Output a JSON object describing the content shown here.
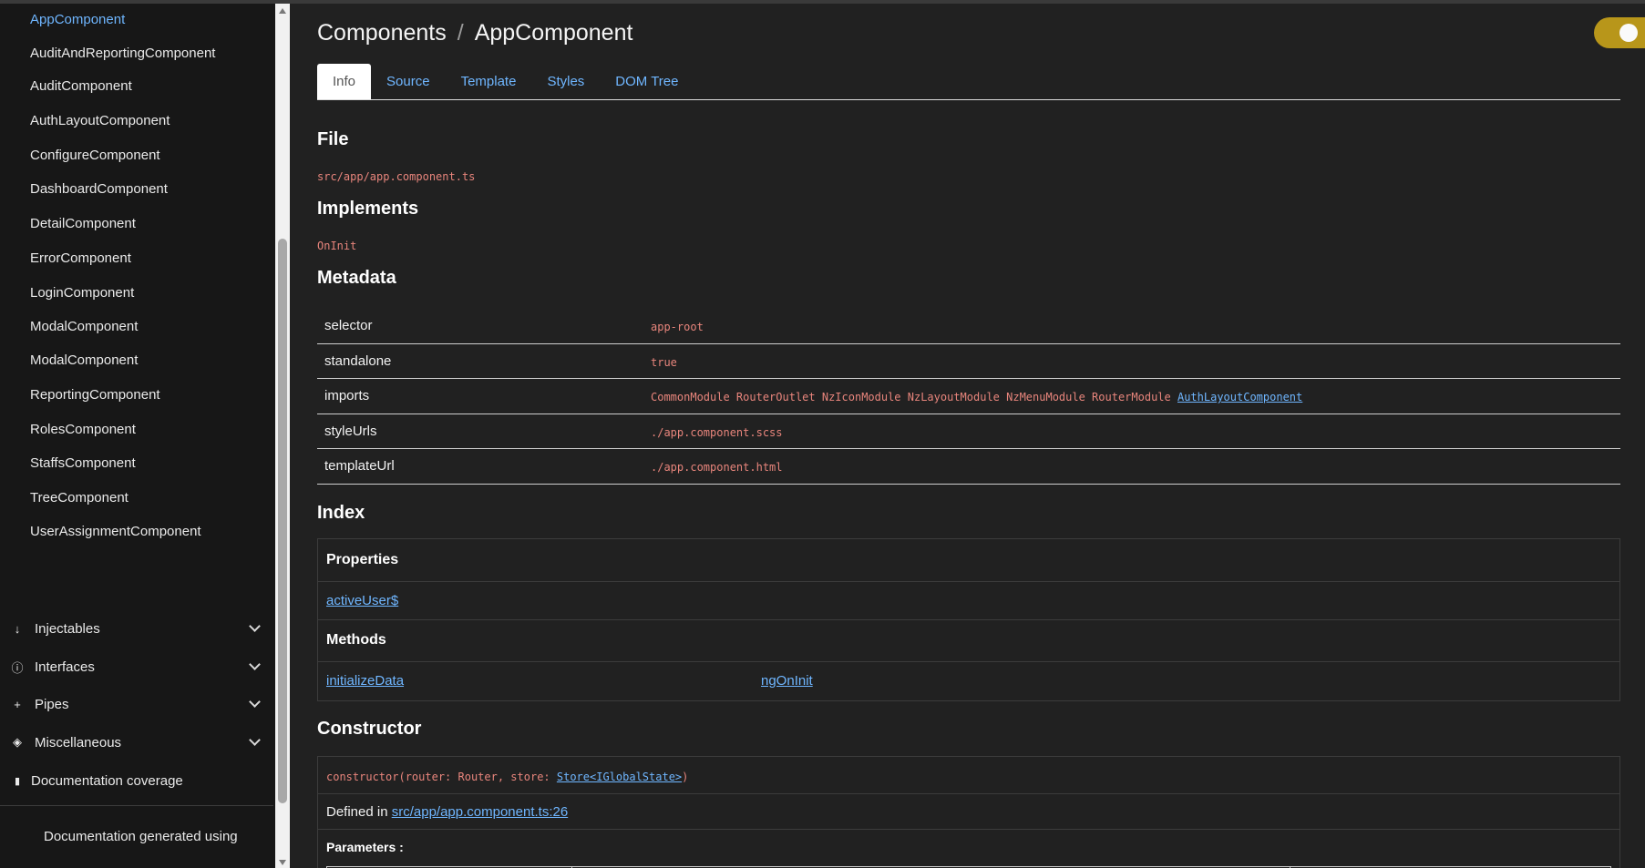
{
  "sidebar": {
    "components": [
      {
        "label": "AppComponent",
        "active": true
      },
      {
        "label": "AuditAndReportingComponent"
      },
      {
        "label": "AuditComponent"
      },
      {
        "label": "AuthLayoutComponent"
      },
      {
        "label": "ConfigureComponent"
      },
      {
        "label": "DashboardComponent"
      },
      {
        "label": "DetailComponent"
      },
      {
        "label": "ErrorComponent"
      },
      {
        "label": "LoginComponent"
      },
      {
        "label": "ModalComponent"
      },
      {
        "label": "ModalComponent"
      },
      {
        "label": "ReportingComponent"
      },
      {
        "label": "RolesComponent"
      },
      {
        "label": "StaffsComponent"
      },
      {
        "label": "TreeComponent"
      },
      {
        "label": "UserAssignmentComponent"
      }
    ],
    "groups": [
      {
        "label": "Injectables",
        "icon": "arrow-down-icon",
        "glyph": "↓"
      },
      {
        "label": "Interfaces",
        "icon": "info-icon",
        "glyph": "ⓘ"
      },
      {
        "label": "Pipes",
        "icon": "plus-icon",
        "glyph": "+"
      },
      {
        "label": "Miscellaneous",
        "icon": "cube-icon",
        "glyph": "◈"
      }
    ],
    "coverage": {
      "label": "Documentation coverage",
      "icon": "bar-chart-icon",
      "glyph": "▮"
    },
    "footer": "Documentation generated using"
  },
  "header": {
    "breadcrumb_parent": "Components",
    "breadcrumb_sep": "/",
    "breadcrumb_current": "AppComponent",
    "theme_toggle_color": "#b8961a"
  },
  "tabs": [
    "Info",
    "Source",
    "Template",
    "Styles",
    "DOM Tree"
  ],
  "file": {
    "heading": "File",
    "path": "src/app/app.component.ts"
  },
  "implements": {
    "heading": "Implements",
    "value": "OnInit"
  },
  "metadata": {
    "heading": "Metadata",
    "rows": [
      {
        "key": "selector",
        "value": "app-root"
      },
      {
        "key": "standalone",
        "value": "true"
      },
      {
        "key": "imports",
        "value": "CommonModule RouterOutlet NzIconModule NzLayoutModule NzMenuModule RouterModule",
        "link": "AuthLayoutComponent"
      },
      {
        "key": "styleUrls",
        "value": "./app.component.scss"
      },
      {
        "key": "templateUrl",
        "value": "./app.component.html"
      }
    ]
  },
  "index": {
    "heading": "Index",
    "properties_heading": "Properties",
    "properties": [
      "activeUser$"
    ],
    "methods_heading": "Methods",
    "methods": [
      "initializeData",
      "ngOnInit"
    ]
  },
  "constructor": {
    "heading": "Constructor",
    "signature_prefix": "constructor(router: Router, store: ",
    "signature_link": "Store<IGlobalState>",
    "signature_suffix": ")",
    "defined_in_label": "Defined in ",
    "defined_in_link": "src/app/app.component.ts:26",
    "parameters_label": "Parameters :"
  },
  "colors": {
    "link": "#6fb6ff",
    "code": "#e8857c",
    "background": "#212121",
    "sidebar": "#171717"
  }
}
